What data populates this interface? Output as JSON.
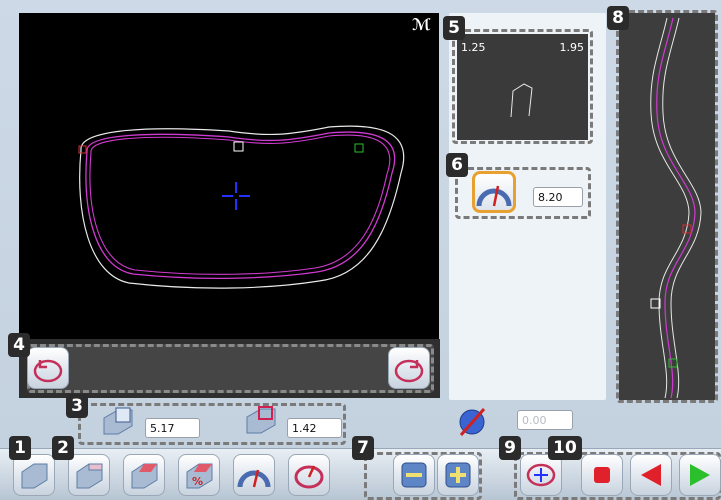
{
  "markers": [
    "1",
    "2",
    "3",
    "4",
    "5",
    "6",
    "7",
    "8",
    "9",
    "10"
  ],
  "viewer": {
    "corner_icon": "measure-icon",
    "corner_glyph": "ℳ"
  },
  "mini_view": {
    "left_value": "1.25",
    "right_value": "1.95"
  },
  "tilt": {
    "value": "8.20"
  },
  "params": {
    "depth_value": "5.17",
    "offset_value": "1.42",
    "angle_value": "0.00"
  },
  "colors": {
    "trace_outer": "#e8e8e8",
    "trace_inner": "#d03ad0",
    "center_cross": "#2233ff",
    "accent_red": "#e0202a",
    "accent_green": "#2bbf2b"
  }
}
